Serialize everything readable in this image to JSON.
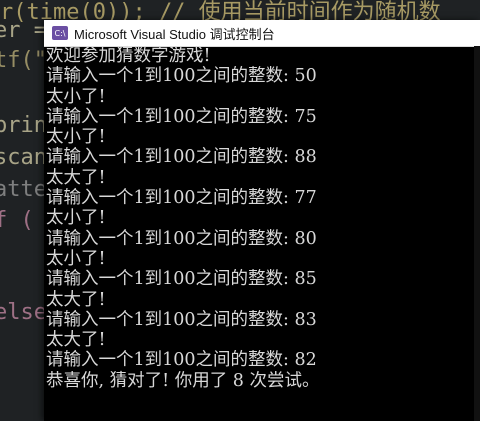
{
  "editor": {
    "top_line": "r(time(0));  // 使用当前时间作为随机数",
    "lines": [
      {
        "text": "er =",
        "cls": "code-line c2"
      },
      {
        "text": "tf(\"",
        "cls": "code-line"
      },
      {
        "text": "",
        "cls": "code-line"
      },
      {
        "text": "prin",
        "cls": "code-line c2"
      },
      {
        "text": "scan",
        "cls": "code-line c2"
      },
      {
        "text": "atte",
        "cls": "code-line c4"
      },
      {
        "text": "f (",
        "cls": "code-line c3"
      },
      {
        "text": "",
        "cls": "code-line"
      },
      {
        "text": "",
        "cls": "code-line"
      },
      {
        "text": "else",
        "cls": "code-line c3"
      }
    ]
  },
  "console": {
    "title": "Microsoft Visual Studio 调试控制台",
    "icon_name": "visual-studio-console-icon",
    "output_lines": [
      "欢迎参加猜数字游戏!",
      "请输入一个1到100之间的整数: 50",
      "太小了!",
      "请输入一个1到100之间的整数: 75",
      "太小了!",
      "请输入一个1到100之间的整数: 88",
      "太大了!",
      "请输入一个1到100之间的整数: 77",
      "太小了!",
      "请输入一个1到100之间的整数: 80",
      "太小了!",
      "请输入一个1到100之间的整数: 85",
      "太大了!",
      "请输入一个1到100之间的整数: 83",
      "太大了!",
      "请输入一个1到100之间的整数: 82",
      "恭喜你, 猜对了! 你用了 8 次尝试。"
    ]
  }
}
